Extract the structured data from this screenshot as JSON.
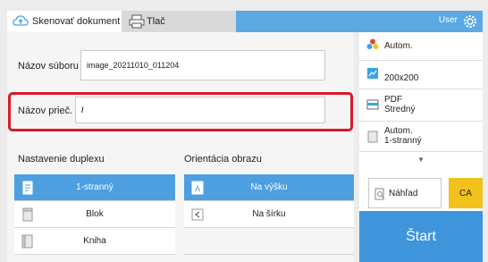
{
  "tabs": {
    "scan_label": "Skenovať dokument",
    "print_label": "Tlač",
    "user_label": "User"
  },
  "fields": {
    "filename_label": "Názov súboru",
    "filename_value": "image_20211010_011204",
    "folder_label": "Názov prieč.",
    "folder_value": "/"
  },
  "duplex": {
    "label": "Nastavenie duplexu",
    "options": [
      "1-stranný",
      "Blok",
      "Kniha"
    ],
    "selected": "1-stranný"
  },
  "orientation": {
    "label": "Orientácia obrazu",
    "options": [
      "Na výšku",
      "Na šírku"
    ],
    "selected": "Na výšku"
  },
  "side_panel": {
    "color_mode": "Autom.",
    "resolution": "200x200",
    "format_line1": "PDF",
    "format_line2": "Stredný",
    "original_line1": "Autom.",
    "original_line2": "1-stranný",
    "more_icon": "chevron-down-icon",
    "preview_label": "Náhľad",
    "ca_label": "CA",
    "start_label": "Štart"
  },
  "colors": {
    "accent": "#4e9fe0",
    "topbar": "#5ba8e2",
    "highlight": "#d7192a",
    "ca_button": "#f1c21b"
  }
}
